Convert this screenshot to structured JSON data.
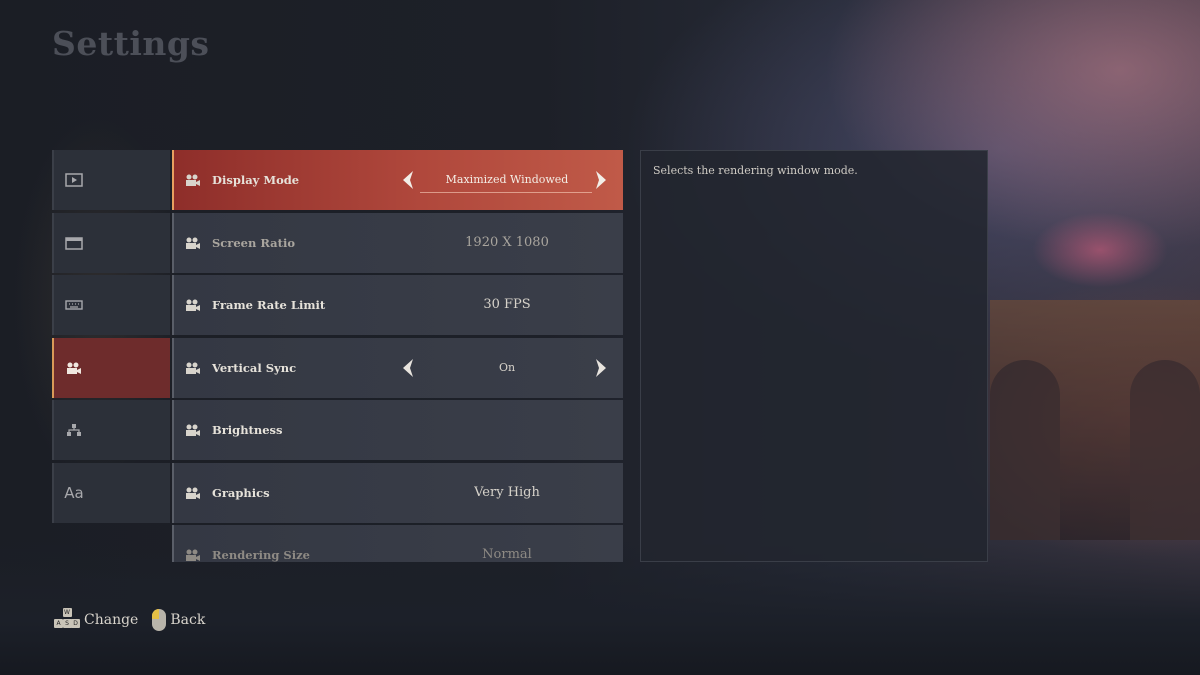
{
  "title": "Settings",
  "categories": [
    {
      "icon": "display-icon",
      "active": false
    },
    {
      "icon": "window-icon",
      "active": false
    },
    {
      "icon": "keyboard-icon",
      "active": false
    },
    {
      "icon": "camera-icon",
      "active": true
    },
    {
      "icon": "network-icon",
      "active": false
    },
    {
      "icon": "language-icon",
      "active": false
    }
  ],
  "settings": [
    {
      "label": "Display Mode",
      "value": "Maximized Windowed",
      "arrows": true,
      "active": true
    },
    {
      "label": "Screen Ratio",
      "value": "1920 X 1080",
      "arrows": false,
      "active": false
    },
    {
      "label": "Frame Rate Limit",
      "value": "30 FPS",
      "arrows": false,
      "active": false
    },
    {
      "label": "Vertical Sync",
      "value": "On",
      "arrows": true,
      "active": false
    },
    {
      "label": "Brightness",
      "value": "",
      "arrows": false,
      "active": false
    },
    {
      "label": "Graphics",
      "value": "Very High",
      "arrows": false,
      "active": false
    },
    {
      "label": "Rendering Size",
      "value": "Normal",
      "arrows": false,
      "active": false
    }
  ],
  "description": "Selects the rendering window mode.",
  "footer": {
    "keys": [
      "W",
      "A",
      "S",
      "D"
    ],
    "change_label": "Change",
    "back_label": "Back"
  },
  "colors": {
    "accent": "#b0483c",
    "active_category": "#6e2c2c",
    "highlight_border": "#e8a060"
  }
}
